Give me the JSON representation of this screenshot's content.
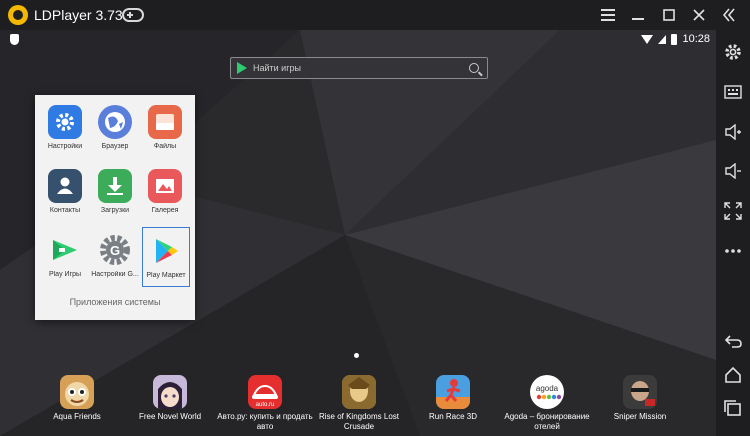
{
  "window": {
    "title": "LDPlayer 3.73"
  },
  "status": {
    "time": "10:28"
  },
  "search": {
    "placeholder": "Найти игры"
  },
  "folder": {
    "title": "Приложения системы",
    "apps": [
      {
        "label": "Настройки",
        "icon": "settings-icon",
        "color": "#2f7be3"
      },
      {
        "label": "Браузер",
        "icon": "browser-icon",
        "color": "#5a7fdb"
      },
      {
        "label": "Файлы",
        "icon": "files-icon",
        "color": "#e8684a"
      },
      {
        "label": "Контакты",
        "icon": "contacts-icon",
        "color": "#36516e"
      },
      {
        "label": "Загрузки",
        "icon": "downloads-icon",
        "color": "#3cab5a"
      },
      {
        "label": "Галерея",
        "icon": "gallery-icon",
        "color": "#e9585b"
      },
      {
        "label": "Play Игры",
        "icon": "play-games-icon",
        "color": "#ffffff"
      },
      {
        "label": "Настройки G...",
        "icon": "google-settings-icon",
        "color": "#ffffff"
      },
      {
        "label": "Play Маркет",
        "icon": "play-market-icon",
        "color": "#ffffff"
      }
    ]
  },
  "dock": [
    {
      "label": "Aqua Friends",
      "icon": "aqua-friends-icon",
      "color": "#d6a056"
    },
    {
      "label": "Free Novel World",
      "icon": "free-novel-world-icon",
      "color": "#c7b9d9"
    },
    {
      "label": "Авто.ру: купить и продать авто",
      "icon": "autoru-icon",
      "color": "#e52f2f"
    },
    {
      "label": "Rise of Kingdoms Lost Crusade",
      "icon": "rise-of-kingdoms-icon",
      "color": "#c99a3a"
    },
    {
      "label": "Run Race 3D",
      "icon": "run-race-3d-icon",
      "color": "#4a9fe0"
    },
    {
      "label": "Agoda – бронирование отелей",
      "icon": "agoda-icon",
      "color": "#ffffff"
    },
    {
      "label": "Sniper Mission",
      "icon": "sniper-mission-icon",
      "color": "#2a2a2a"
    }
  ]
}
